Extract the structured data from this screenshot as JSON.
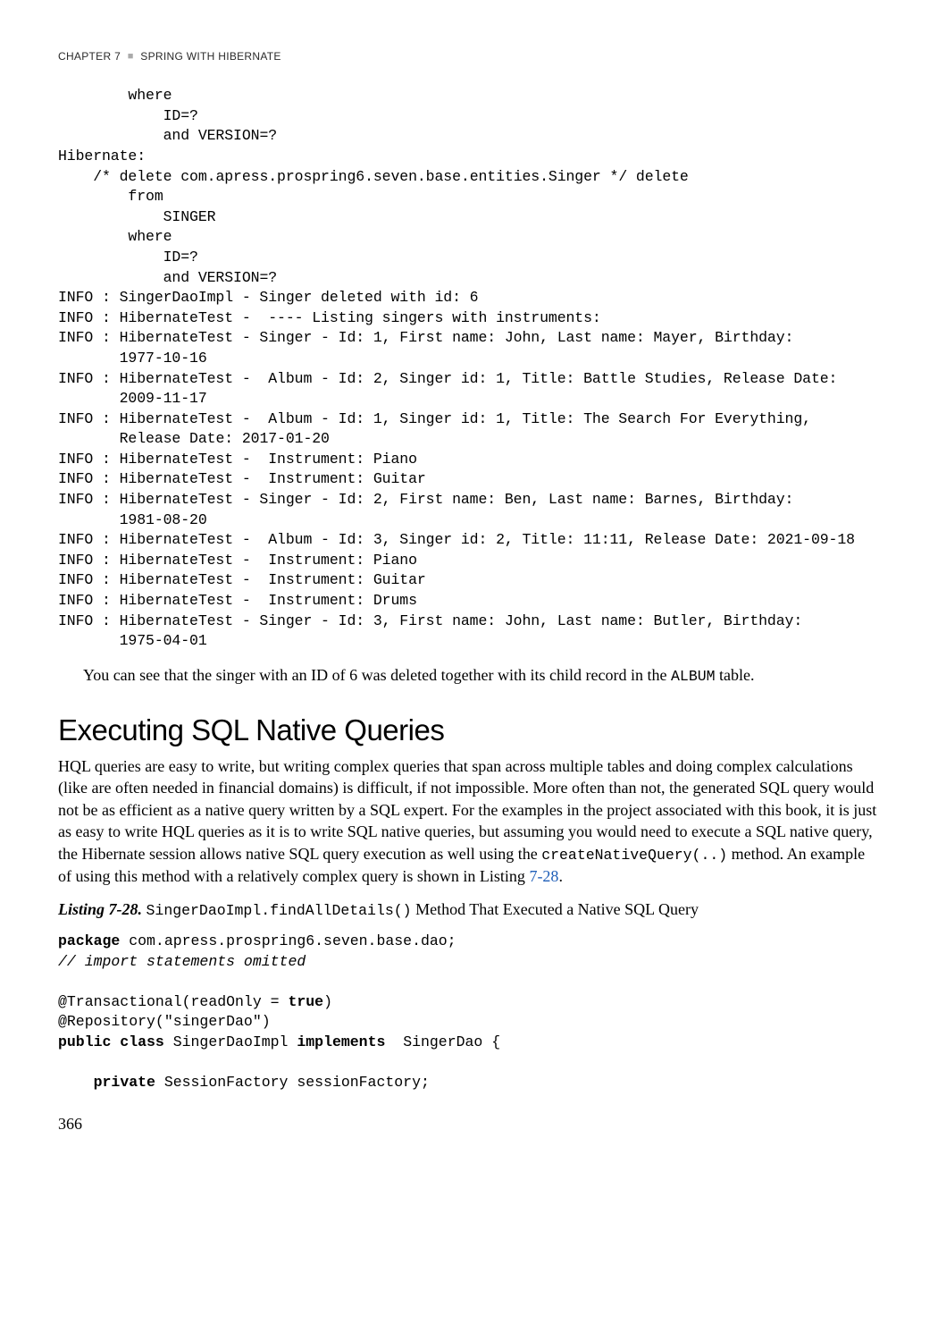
{
  "header": {
    "chapter": "CHAPTER 7",
    "title": "SPRING WITH HIBERNATE"
  },
  "codeBlock": "        where\n            ID=?\n            and VERSION=?\nHibernate:\n    /* delete com.apress.prospring6.seven.base.entities.Singer */ delete\n        from\n            SINGER\n        where\n            ID=?\n            and VERSION=?\nINFO : SingerDaoImpl - Singer deleted with id: 6\nINFO : HibernateTest -  ---- Listing singers with instruments:\nINFO : HibernateTest - Singer - Id: 1, First name: John, Last name: Mayer, Birthday:\n       1977-10-16\nINFO : HibernateTest -  Album - Id: 2, Singer id: 1, Title: Battle Studies, Release Date:\n       2009-11-17\nINFO : HibernateTest -  Album - Id: 1, Singer id: 1, Title: The Search For Everything,\n       Release Date: 2017-01-20\nINFO : HibernateTest -  Instrument: Piano\nINFO : HibernateTest -  Instrument: Guitar\nINFO : HibernateTest - Singer - Id: 2, First name: Ben, Last name: Barnes, Birthday:\n       1981-08-20\nINFO : HibernateTest -  Album - Id: 3, Singer id: 2, Title: 11:11, Release Date: 2021-09-18\nINFO : HibernateTest -  Instrument: Piano\nINFO : HibernateTest -  Instrument: Guitar\nINFO : HibernateTest -  Instrument: Drums\nINFO : HibernateTest - Singer - Id: 3, First name: John, Last name: Butler, Birthday:\n       1975-04-01",
  "para1": {
    "pre": "You can see that the singer with an ID of 6 was deleted together with its child record in the ",
    "mono": "ALBUM",
    "post": " table."
  },
  "sectionHeading": "Executing SQL Native Queries",
  "para2": {
    "t1": "HQL queries are easy to write, but writing complex queries that span across multiple tables and doing complex calculations (like are often needed in financial domains) is difficult, if not impossible. More often than not, the generated SQL query would not be as efficient as a native query written by a SQL expert. For the examples in the project associated with this book, it is just as easy to write HQL queries as it is to write SQL native queries, but assuming you would need to execute a SQL native query, the Hibernate session allows native SQL query execution as well using the ",
    "mono1": "createNativeQuery(..)",
    "t2": " method. An example of using this method with a relatively complex query is shown in Listing ",
    "link": "7-28",
    "t3": "."
  },
  "listingCaption": {
    "label": "Listing 7-28.",
    "mono": "SingerDaoImpl.findAllDetails()",
    "rest": " Method That Executed a Native SQL Query"
  },
  "codeListing": {
    "kw_package": "package",
    "pkg": " com.apress.prospring6.seven.base.dao;",
    "comment": "// import statements omitted",
    "anno1_pre": "@Transactional(readOnly = ",
    "kw_true": "true",
    "anno1_post": ")",
    "anno2": "@Repository(\"singerDao\")",
    "kw_public_class": "public class",
    "class_name": " SingerDaoImpl ",
    "kw_implements": "implements",
    "iface": "  SingerDao {",
    "kw_private": "private",
    "field": " SessionFactory sessionFactory;"
  },
  "pageNumber": "366"
}
